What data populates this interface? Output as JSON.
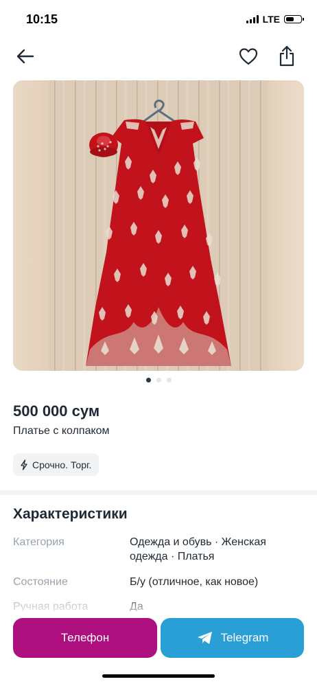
{
  "status_bar": {
    "time": "10:15",
    "network": "LTE",
    "battery_level": 0.6
  },
  "nav": {
    "back_icon": "arrow-left-icon",
    "favorite_icon": "heart-icon",
    "share_icon": "share-icon"
  },
  "gallery": {
    "image_count": 3,
    "active_index": 0
  },
  "listing": {
    "price": "500 000 сум",
    "title": "Платье с колпаком",
    "badge": {
      "icon": "lightning-icon",
      "label": "Срочно. Торг."
    }
  },
  "characteristics": {
    "heading": "Характеристики",
    "rows": [
      {
        "key": "Категория",
        "value": "Одежда и обувь · Женская одежда · Платья"
      },
      {
        "key": "Состояние",
        "value": "Б/у (отличное, как новое)"
      },
      {
        "key": "Ручная работа",
        "value": "Да"
      }
    ]
  },
  "actions": {
    "phone_label": "Телефон",
    "telegram_label": "Telegram",
    "phone_color": "#ae0f7f",
    "telegram_color": "#2a9fd6"
  }
}
